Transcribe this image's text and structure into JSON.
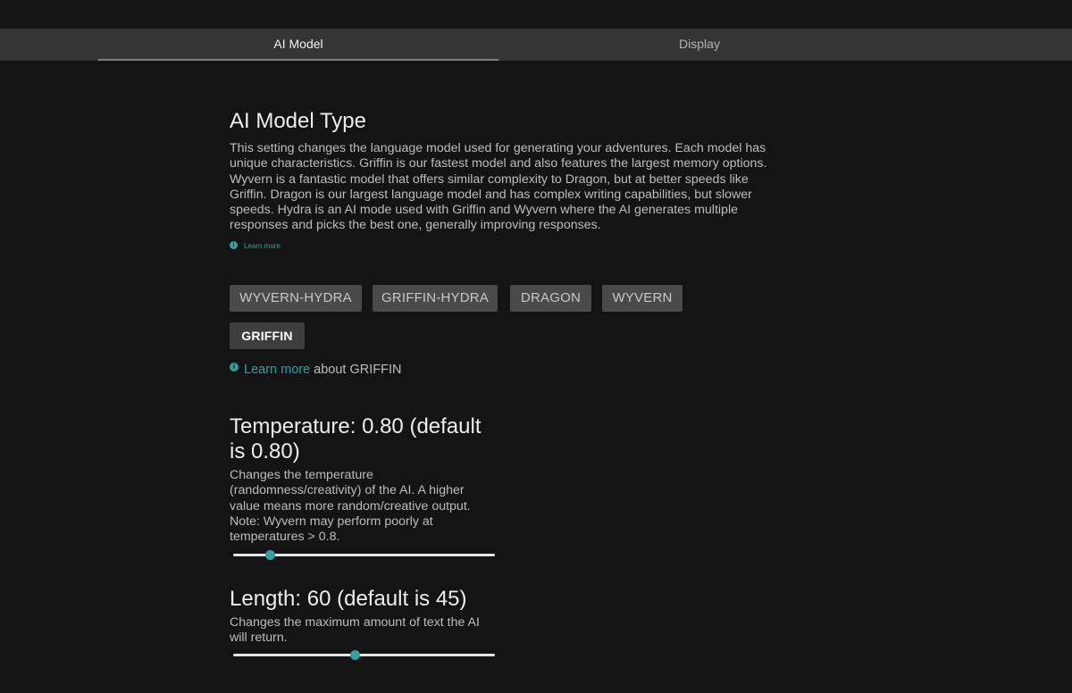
{
  "tabs": [
    {
      "label": "AI Model",
      "active": true
    },
    {
      "label": "Display",
      "active": false
    }
  ],
  "model_section": {
    "title": "AI Model Type",
    "description": "This setting changes the language model used for generating your adventures. Each model has unique characteristics. Griffin is our fastest model and also features the largest memory options. Wyvern is a fantastic model that offers similar complexity to Dragon, but at better speeds like Griffin. Dragon is our largest language model and has complex writing capabilities, but slower speeds. Hydra is an AI mode used with Griffin and Wyvern where the AI generates multiple responses and picks the best one, generally improving responses.",
    "learn_more": "Learn more",
    "info_icon": "i",
    "models": [
      "WYVERN-HYDRA",
      "GRIFFIN-HYDRA",
      "DRAGON",
      "WYVERN",
      "GRIFFIN"
    ],
    "selected_model": "GRIFFIN",
    "learn_more_link": "Learn more",
    "learn_more_suffix": "about GRIFFIN"
  },
  "temperature": {
    "title": "Temperature: 0.80 (default is 0.80)",
    "description": "Changes the temperature (randomness/creativity) of the AI. A higher value means more random/creative output. Note: Wyvern may perform poorly at temperatures > 0.8.",
    "slider_fraction": 0.14
  },
  "length": {
    "title": "Length: 60 (default is 45)",
    "description": "Changes the maximum amount of text the AI will return.",
    "slider_fraction": 0.465
  },
  "colors": {
    "background": "#141414",
    "tabbar": "#353535",
    "accent": "#34a0a0",
    "button": "#4a4a4a"
  }
}
